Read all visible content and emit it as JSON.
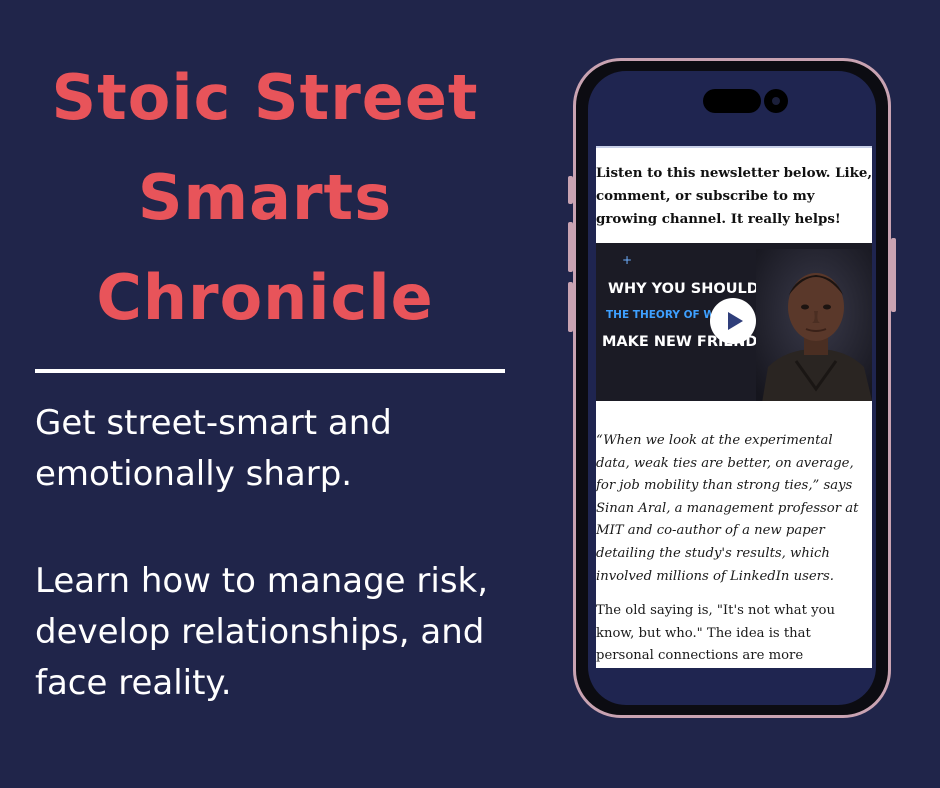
{
  "heading": {
    "lines": [
      "Stoic Street",
      "Smarts",
      "Chronicle"
    ]
  },
  "taglines": {
    "first": [
      "Get street-smart and",
      "emotionally sharp."
    ],
    "second": [
      "Learn how to manage risk,",
      "develop relationships, and",
      "face reality."
    ]
  },
  "phone": {
    "intro_lines": [
      "Listen to this newsletter below. Like,",
      "comment, or subscribe to my",
      "growing channel. It really helps!"
    ],
    "video": {
      "line1": "WHY YOU SHOULD",
      "line2": "THE THEORY OF WEAK",
      "line3": "MAKE NEW FRIENDS",
      "play_icon": "play-icon"
    },
    "quote_lines": [
      "“When we look at the experimental",
      "data, weak ties are better, on average,",
      "for job mobility than strong ties,” says",
      "Sinan Aral, a management professor at",
      "MIT and co-author of a new paper",
      "detailing the study's results, which",
      "involved millions of LinkedIn users."
    ],
    "body_lines": [
      "The old saying is, \"It's not what you",
      "know, but who.\" The idea is that",
      "personal connections are more"
    ]
  },
  "colors": {
    "background": "#20254a",
    "accent": "#e8545a",
    "text": "#ffffff"
  }
}
